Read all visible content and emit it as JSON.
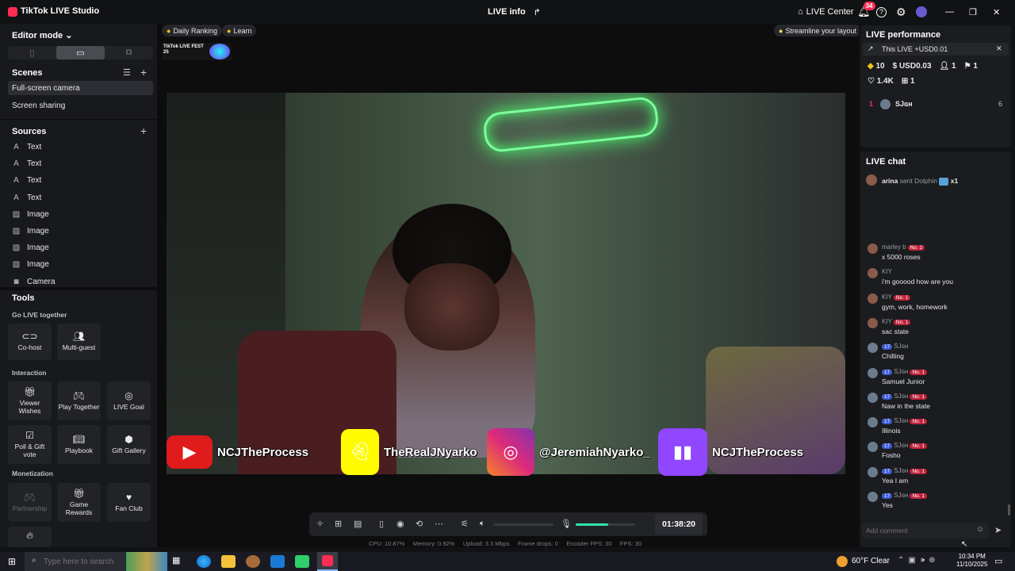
{
  "titlebar": {
    "app_title": "TikTok LIVE Studio",
    "live_info": "LIVE info",
    "live_center": "LIVE Center",
    "notification_count": "34"
  },
  "left": {
    "editor_mode": "Editor mode",
    "scenes_title": "Scenes",
    "scenes": [
      "Full-screen camera",
      "Screen sharing"
    ],
    "sources_title": "Sources",
    "sources": [
      {
        "icon": "text-icon",
        "label": "Text"
      },
      {
        "icon": "text-icon",
        "label": "Text"
      },
      {
        "icon": "text-icon",
        "label": "Text"
      },
      {
        "icon": "text-icon",
        "label": "Text"
      },
      {
        "icon": "image-icon",
        "label": "Image"
      },
      {
        "icon": "image-icon",
        "label": "Image"
      },
      {
        "icon": "image-icon",
        "label": "Image"
      },
      {
        "icon": "image-icon",
        "label": "Image"
      },
      {
        "icon": "camera-icon",
        "label": "Camera"
      }
    ],
    "tools_title": "Tools",
    "go_live_together": "Go LIVE together",
    "interaction": "Interaction",
    "monetization": "Monetization",
    "tools_go_live": [
      "Co-host",
      "Multi-guest"
    ],
    "tools_interaction_row1": [
      "Viewer Wishes",
      "Play Together",
      "LIVE Goal"
    ],
    "tools_interaction_row2": [
      "Poll & Gift vote",
      "Playbook",
      "Gift Gallery"
    ],
    "tools_monetization": [
      "Partnership",
      "Game Rewards",
      "Fan Club"
    ]
  },
  "center": {
    "daily_ranking": "Daily Ranking",
    "learn": "Learn",
    "streamline": "Streamline your layout",
    "fest_logo": "TikTok LIVE FEST 25",
    "socials": [
      {
        "platform": "youtube",
        "handle": "NCJTheProcess",
        "color": "#e01b1b"
      },
      {
        "platform": "snapchat",
        "handle": "TheRealJNyarko",
        "color": "#fffc00"
      },
      {
        "platform": "instagram",
        "handle": "@JeremiahNyarko_",
        "color": "#c92f8a"
      },
      {
        "platform": "twitch",
        "handle": "NCJTheProcess",
        "color": "#9146ff"
      }
    ],
    "timer": "01:38:20",
    "mic_level_percent": 55,
    "stats": {
      "cpu": "CPU: 10.87%",
      "memory": "Memory: 0.92%",
      "upload": "Upload: 3.3 Mbps",
      "frame_drops": "Frame drops: 0",
      "encoder_fps": "Encoder FPS: 30",
      "fps": "FPS: 30"
    }
  },
  "right": {
    "performance_title": "LIVE performance",
    "this_live": "This LIVE +USD0.01",
    "diamonds": "10",
    "usd": "USD0.03",
    "viewers": "1",
    "new_followers": "1",
    "likes": "1.4K",
    "gifts": "1",
    "top_rank": "1",
    "top_name": "SJɢʜ",
    "top_score": "6",
    "chat_title": "LIVE chat",
    "gift_sender": "arina",
    "gift_text": "sent Dolphin",
    "gift_count": "x1",
    "chat": [
      {
        "name": "marley b",
        "level": "",
        "rank": "No. 2",
        "msg": "x 5000 roses"
      },
      {
        "name": "KIY",
        "level": "",
        "rank": "",
        "msg": "i'm gooood how are you"
      },
      {
        "name": "KIY",
        "level": "",
        "rank": "No. 1",
        "msg": "gym, work, homework"
      },
      {
        "name": "KIY",
        "level": "",
        "rank": "No. 1",
        "msg": "sac state"
      },
      {
        "name": "SJɢʜ",
        "level": "17",
        "rank": "",
        "msg": "Chilling"
      },
      {
        "name": "SJɢʜ",
        "level": "17",
        "rank": "No. 1",
        "msg": "Samuel Junior"
      },
      {
        "name": "SJɢʜ",
        "level": "17",
        "rank": "No. 1",
        "msg": "Naw in the state"
      },
      {
        "name": "SJɢʜ",
        "level": "17",
        "rank": "No. 1",
        "msg": "Illinois"
      },
      {
        "name": "SJɢʜ",
        "level": "17",
        "rank": "No. 1",
        "msg": "Fosho"
      },
      {
        "name": "SJɢʜ",
        "level": "17",
        "rank": "No. 1",
        "msg": "Yea I am"
      },
      {
        "name": "SJɢʜ",
        "level": "17",
        "rank": "No. 1",
        "msg": "Yes"
      }
    ],
    "comment_placeholder": "Add comment"
  },
  "taskbar": {
    "search_placeholder": "Type here to search",
    "weather": "60°F Clear",
    "time": "10:34 PM",
    "date": "11/10/2025"
  }
}
